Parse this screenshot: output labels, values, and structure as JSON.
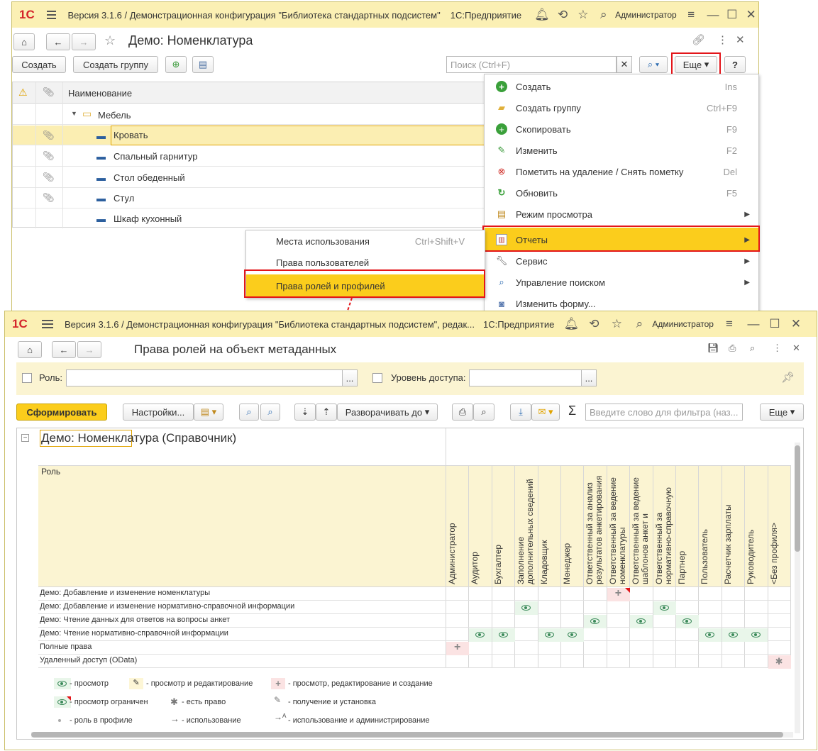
{
  "top": {
    "logo": "1С",
    "title": "Версия 3.1.6 / Демонстрационная конфигурация \"Библиотека стандартных подсистем\"",
    "app": "1С:Предприятие",
    "user": "Администратор",
    "form_title": "Демо: Номенклатура",
    "create_btn": "Создать",
    "create_group_btn": "Создать группу",
    "search_placeholder": "Поиск (Ctrl+F)",
    "more_btn": "Еще",
    "help_btn": "?",
    "col_name": "Наименование",
    "items": [
      {
        "label": "Мебель",
        "type": "group"
      },
      {
        "label": "Кровать",
        "type": "item"
      },
      {
        "label": "Спальный гарнитур",
        "type": "item"
      },
      {
        "label": "Стол обеденный",
        "type": "item"
      },
      {
        "label": "Стул",
        "type": "item"
      },
      {
        "label": "Шкаф кухонный",
        "type": "item"
      }
    ]
  },
  "more_menu": [
    {
      "label": "Создать",
      "shortcut": "Ins",
      "icon": "plus-circle-icon"
    },
    {
      "label": "Создать группу",
      "shortcut": "Ctrl+F9",
      "icon": "folder-plus-icon"
    },
    {
      "label": "Скопировать",
      "shortcut": "F9",
      "icon": "copy-icon"
    },
    {
      "label": "Изменить",
      "shortcut": "F2",
      "icon": "pencil-icon"
    },
    {
      "label": "Пометить на удаление / Снять пометку",
      "shortcut": "Del",
      "icon": "delete-mark-icon"
    },
    {
      "label": "Обновить",
      "shortcut": "F5",
      "icon": "refresh-icon"
    },
    {
      "label": "Режим просмотра",
      "shortcut": "",
      "icon": "view-mode-icon"
    },
    {
      "label": "Отчеты",
      "shortcut": "",
      "icon": "reports-icon"
    },
    {
      "label": "Сервис",
      "shortcut": "",
      "icon": "wrench-icon"
    },
    {
      "label": "Управление поиском",
      "shortcut": "",
      "icon": "search-icon"
    },
    {
      "label": "Изменить форму...",
      "shortcut": "",
      "icon": "form-icon"
    }
  ],
  "reports_menu": [
    {
      "label": "Места использования",
      "shortcut": "Ctrl+Shift+V"
    },
    {
      "label": "Права пользователей",
      "shortcut": ""
    },
    {
      "label": "Права ролей и профилей",
      "shortcut": ""
    }
  ],
  "bottom": {
    "title": "Версия 3.1.6 / Демонстрационная конфигурация \"Библиотека стандартных подсистем\", редак...",
    "app": "1С:Предприятие",
    "user": "Администратор",
    "form_title": "Права ролей на объект метаданных",
    "role_label": "Роль:",
    "access_label": "Уровень доступа:",
    "generate_btn": "Сформировать",
    "settings_btn": "Настройки...",
    "expand_btn": "Разворачивать до",
    "filter_placeholder": "Введите слово для фильтра (наз...",
    "more_btn": "Еще",
    "sigma": "Σ",
    "report_title": "Демо: Номенклатура (Справочник)",
    "role_header": "Роль",
    "profiles": [
      "Администратор",
      "Аудитор",
      "Бухгалтер",
      "Заполнение\nдополнительных сведений",
      "Кладовщик",
      "Менеджер",
      "Ответственный за анализ\nрезультатов анкетирования",
      "Ответственный за ведение\nноменклатуры",
      "Ответственный за ведение\nшаблонов анкет и",
      "Ответственный за\nнормативно-справочную",
      "Партнер",
      "Пользователь",
      "Расчетчик зарплаты",
      "Руководитель",
      "<Без профиля>"
    ],
    "rows": [
      {
        "label": "Демо: Добавление и изменение номенклатуры",
        "marks": [
          {
            "col": 7,
            "type": "plus-restricted"
          }
        ]
      },
      {
        "label": "Демо: Добавление и изменение нормативно-справочной информации",
        "marks": [
          {
            "col": 3,
            "type": "eye"
          },
          {
            "col": 9,
            "type": "eye"
          }
        ]
      },
      {
        "label": "Демо: Чтение данных для ответов на вопросы анкет",
        "marks": [
          {
            "col": 6,
            "type": "eye"
          },
          {
            "col": 8,
            "type": "eye"
          },
          {
            "col": 10,
            "type": "eye"
          }
        ]
      },
      {
        "label": "Демо: Чтение нормативно-справочной информации",
        "marks": [
          {
            "col": 1,
            "type": "eye"
          },
          {
            "col": 2,
            "type": "eye"
          },
          {
            "col": 4,
            "type": "eye"
          },
          {
            "col": 5,
            "type": "eye"
          },
          {
            "col": 11,
            "type": "eye"
          },
          {
            "col": 12,
            "type": "eye"
          },
          {
            "col": 13,
            "type": "eye"
          }
        ]
      },
      {
        "label": "Полные права",
        "marks": [
          {
            "col": 0,
            "type": "plus"
          }
        ]
      },
      {
        "label": "Удаленный доступ (OData)",
        "marks": [
          {
            "col": 14,
            "type": "star"
          }
        ]
      }
    ],
    "legend": [
      {
        "text": "- просмотр"
      },
      {
        "text": "- просмотр и редактирование"
      },
      {
        "text": "- просмотр, редактирование и создание"
      },
      {
        "text": "- просмотр ограничен"
      },
      {
        "text": "- есть право"
      },
      {
        "text": "- получение и установка"
      },
      {
        "text": "- роль в профиле"
      },
      {
        "text": "- использование"
      },
      {
        "text": "- использование и администрирование"
      }
    ]
  },
  "colors": {
    "accent": "#fbcd1c",
    "highlight": "#e3151a",
    "titlebar": "#fbf0b4"
  }
}
